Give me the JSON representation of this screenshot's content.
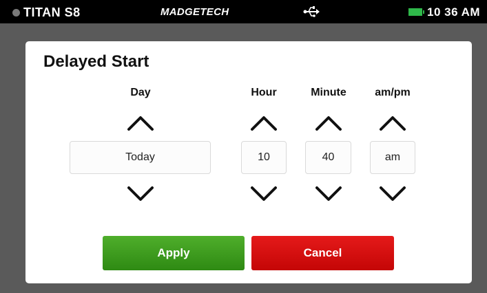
{
  "status_bar": {
    "device_name": "TITAN S8",
    "brand": "MADGETECH",
    "usb_icon": "usb-icon",
    "battery_icon": "battery-icon",
    "battery_color": "#2fb84a",
    "time": "10 36 AM"
  },
  "dialog": {
    "title": "Delayed Start",
    "columns": {
      "day": {
        "label": "Day",
        "value": "Today"
      },
      "hour": {
        "label": "Hour",
        "value": "10"
      },
      "minute": {
        "label": "Minute",
        "value": "40"
      },
      "ampm": {
        "label": "am/pm",
        "value": "am"
      }
    },
    "apply_label": "Apply",
    "cancel_label": "Cancel",
    "apply_color": "#3d9b1f",
    "cancel_color": "#d40f0f"
  }
}
